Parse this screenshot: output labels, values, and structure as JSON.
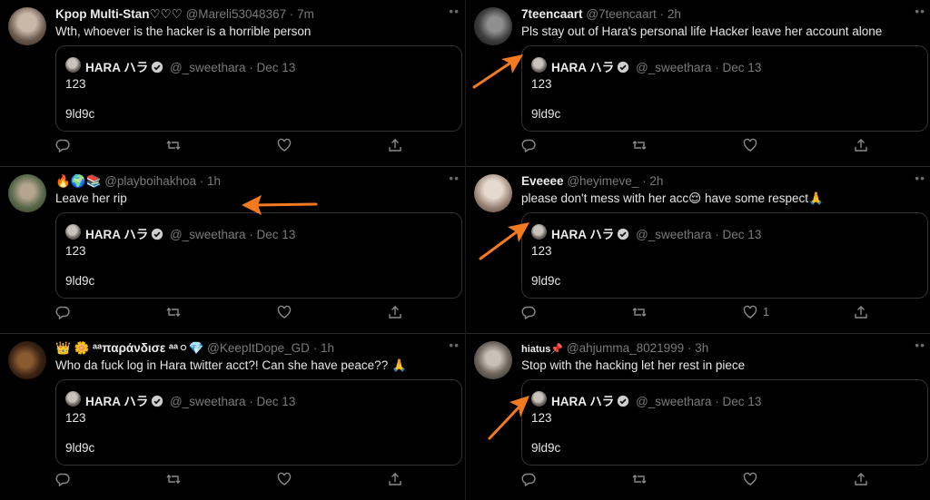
{
  "tweets": [
    {
      "name": "Kpop Multi-Stan♡♡♡",
      "handle": "@Mareli53048367",
      "time": "7m",
      "text": "Wth, whoever is the hacker is a horrible person",
      "likes": ""
    },
    {
      "name": "🔥🌍📚",
      "handle": "@playboihakhoa",
      "time": "1h",
      "text": "Leave her rip",
      "likes": ""
    },
    {
      "name": "👑 🌼 ᵃᵃπαράνδισε ᵃᵃ⚪💎",
      "handle": "@KeepItDope_GD",
      "time": "1h",
      "text": "Who da fuck log in Hara twitter acct?! Can she have peace?? 🙏",
      "likes": ""
    },
    {
      "name": "7teencaart",
      "handle": "@7teencaart",
      "time": "2h",
      "text": "Pls stay out of Hara's personal life Hacker leave her account alone",
      "likes": ""
    },
    {
      "name": "Eveeee",
      "handle": "@heyimeve_",
      "time": "2h",
      "text": "please don't mess with her acc😌 have some respect🙏",
      "likes": "1"
    },
    {
      "name": "hiatus📌",
      "handle": "@ahjumma_8021999",
      "time": "3h",
      "text": "Stop with the hacking let her rest in piece",
      "likes": ""
    }
  ],
  "quoted": {
    "name": "HARA ハラ",
    "handle": "@_sweethara",
    "date": "Dec 13",
    "line1": "123",
    "line2": "9ld9c"
  },
  "separator": "·",
  "more": "••",
  "colors": {
    "background": "#000000",
    "arrow": "#f47a20",
    "verified": "#cfcfcf"
  }
}
